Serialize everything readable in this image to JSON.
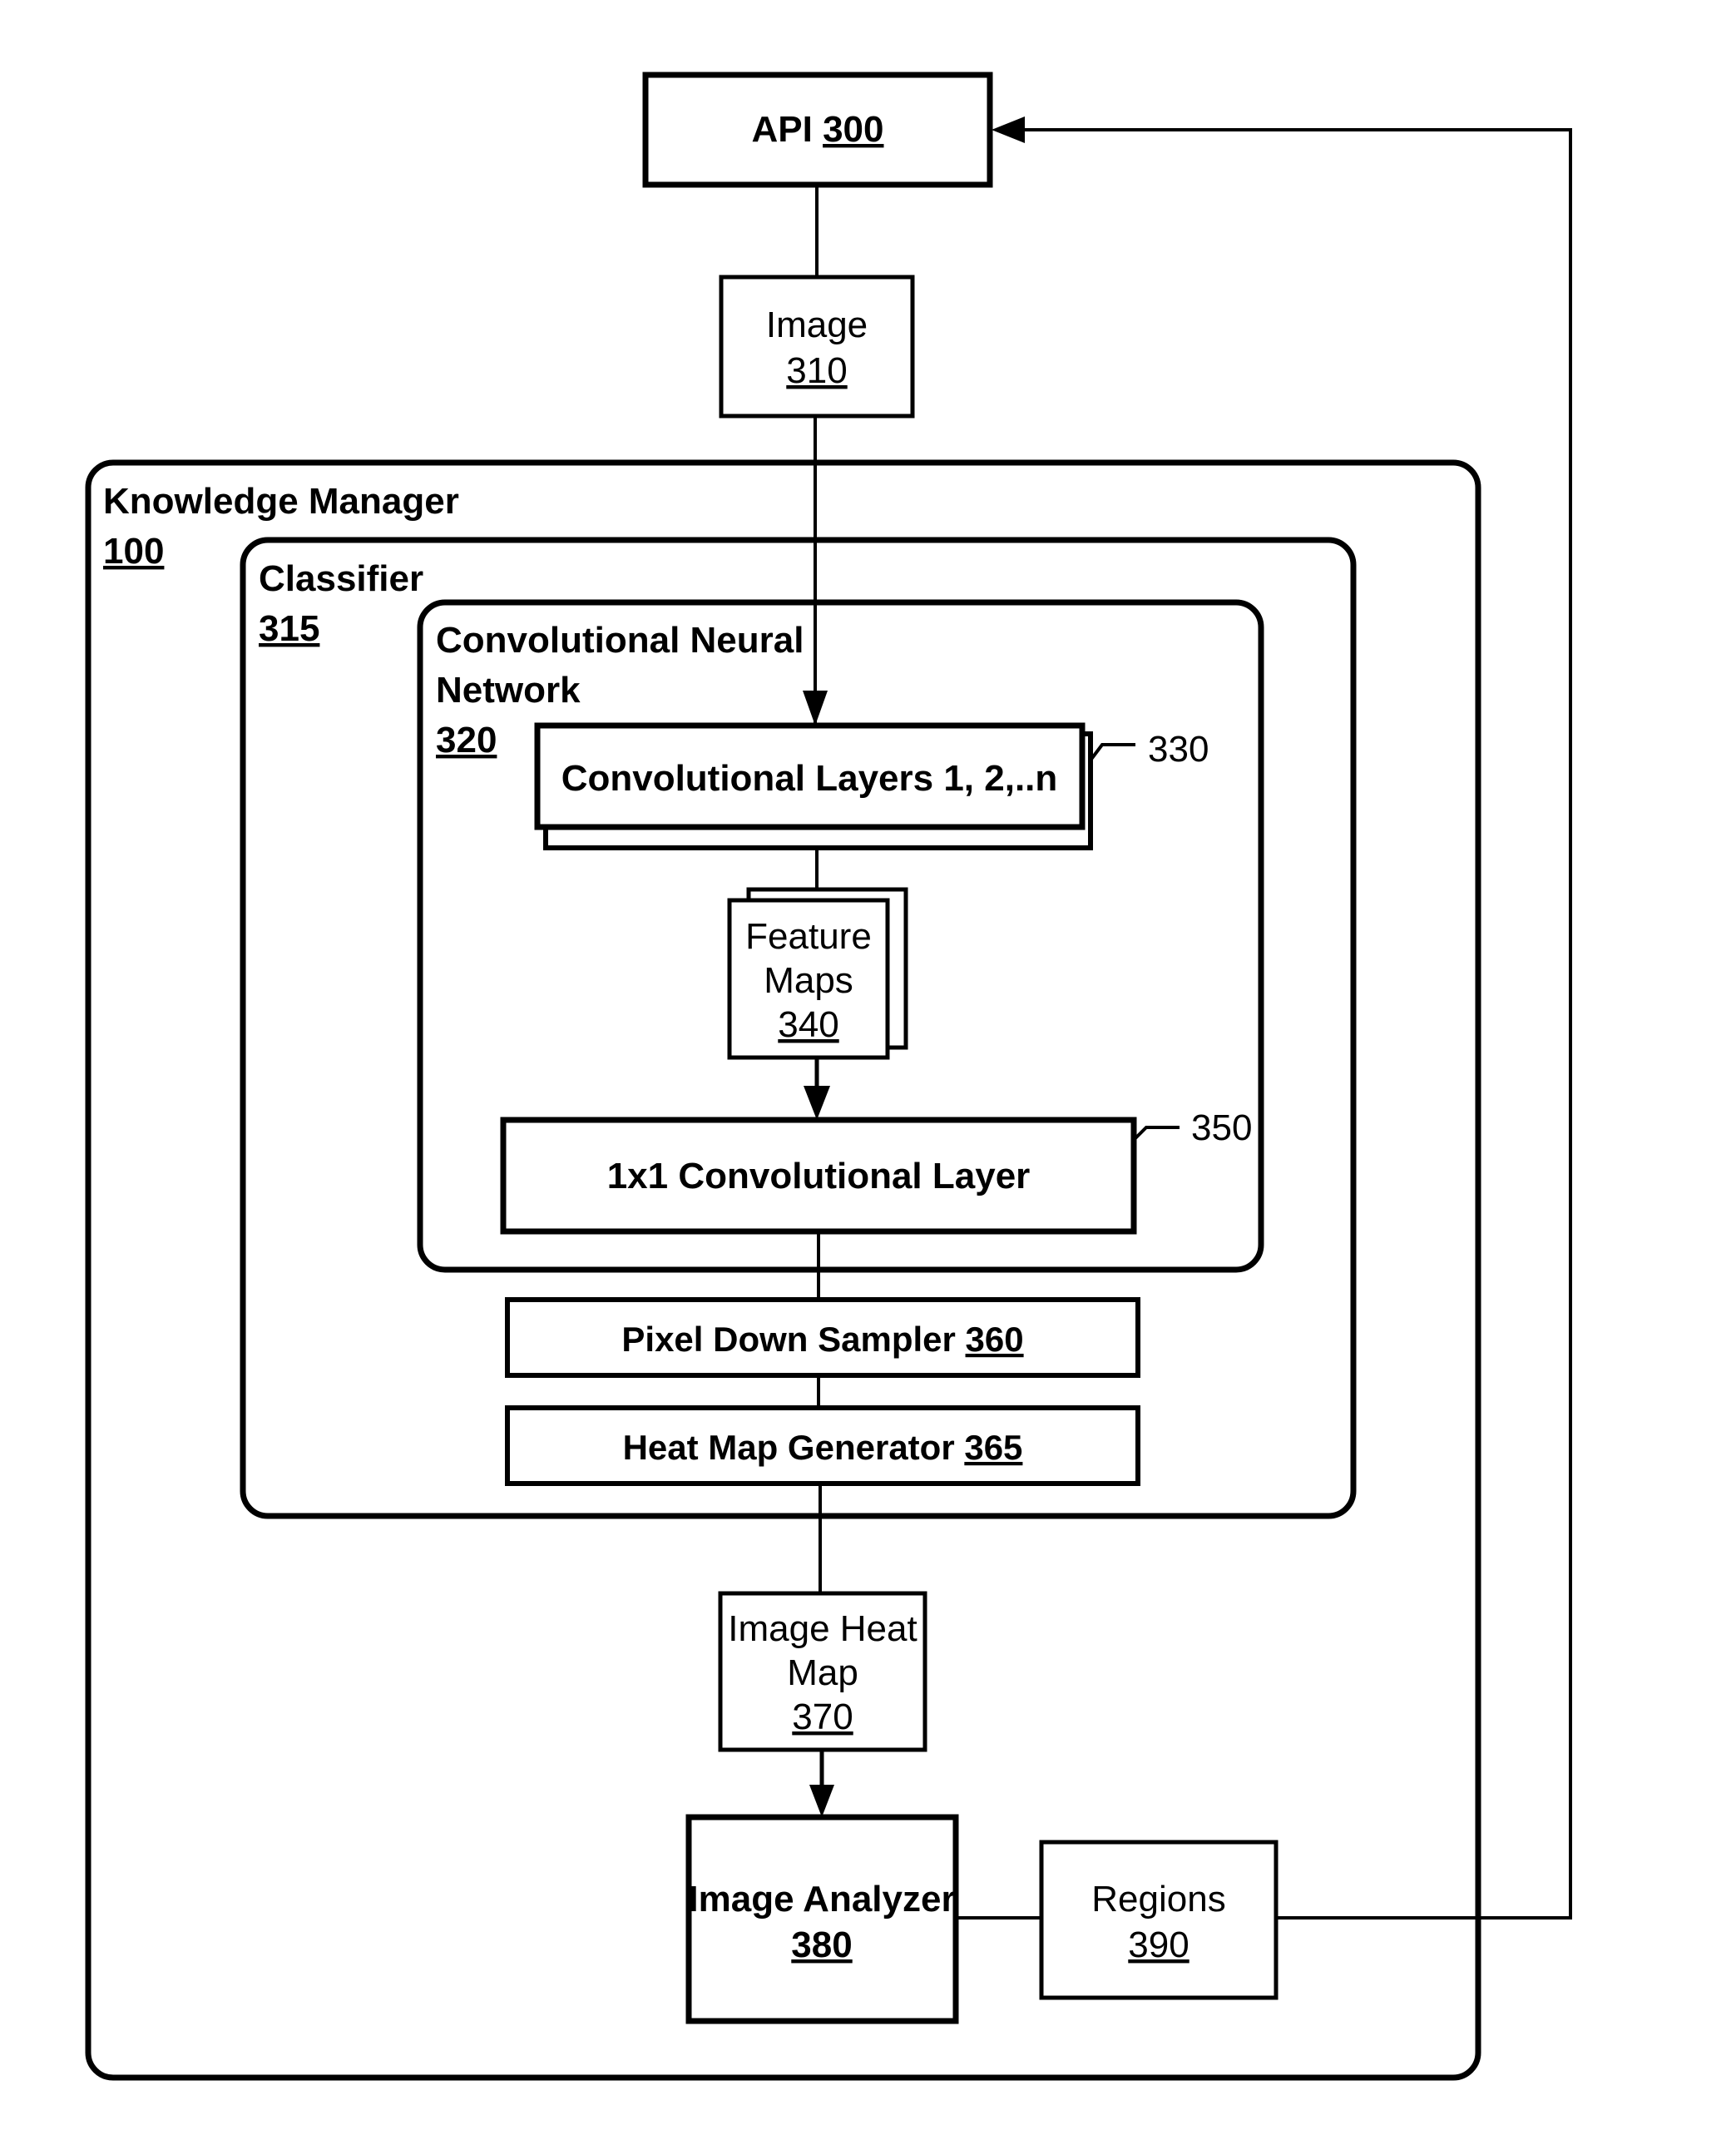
{
  "diagram": {
    "api": {
      "label": "API",
      "ref": "300"
    },
    "image": {
      "label": "Image",
      "ref": "310"
    },
    "knowledge_manager": {
      "label": "Knowledge Manager",
      "ref": "100"
    },
    "classifier": {
      "label": "Classifier",
      "ref": "315"
    },
    "cnn": {
      "label_line1": "Convolutional Neural",
      "label_line2": "Network",
      "ref": "320"
    },
    "conv_layers": {
      "label": "Convolutional Layers 1, 2,..n",
      "ref": "330"
    },
    "feature_maps": {
      "label_line1": "Feature",
      "label_line2": "Maps",
      "ref": "340"
    },
    "conv_1x1": {
      "label": "1x1 Convolutional Layer",
      "ref": "350"
    },
    "pixel_down_sampler": {
      "label": "Pixel Down Sampler",
      "ref": "360"
    },
    "heat_map_generator": {
      "label": "Heat Map Generator",
      "ref": "365"
    },
    "image_heat_map": {
      "label_line1": "Image Heat",
      "label_line2": "Map",
      "ref": "370"
    },
    "image_analyzer": {
      "label": "Image Analyzer",
      "ref": "380"
    },
    "regions": {
      "label": "Regions",
      "ref": "390"
    }
  }
}
